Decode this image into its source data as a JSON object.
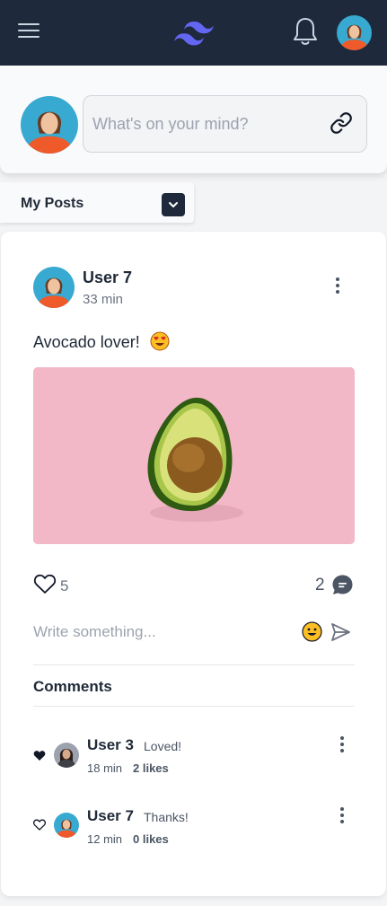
{
  "header": {
    "menu_icon": "hamburger-menu-icon",
    "logo_icon": "tailwind-logo-icon",
    "notification_icon": "bell-icon",
    "brand_color": "#6366f1",
    "background_color": "#1e293b"
  },
  "composer": {
    "placeholder": "What's on your mind?",
    "attach_icon": "link-icon"
  },
  "filter": {
    "label": "My Posts",
    "icon": "chevron-down-icon"
  },
  "post": {
    "user": "User 7",
    "time": "33 min",
    "text": "Avocado lover!",
    "text_emoji": "heart-eyes-emoji",
    "image_subject": "avocado-half-on-pink",
    "likes": "5",
    "comments": "2",
    "reply_placeholder": "Write something..."
  },
  "comments": {
    "title": "Comments",
    "items": [
      {
        "user": "User 3",
        "text": "Loved!",
        "time": "18 min",
        "likes": "2 likes",
        "liked": true
      },
      {
        "user": "User 7",
        "text": "Thanks!",
        "time": "12 min",
        "likes": "0 likes",
        "liked": false
      }
    ]
  }
}
